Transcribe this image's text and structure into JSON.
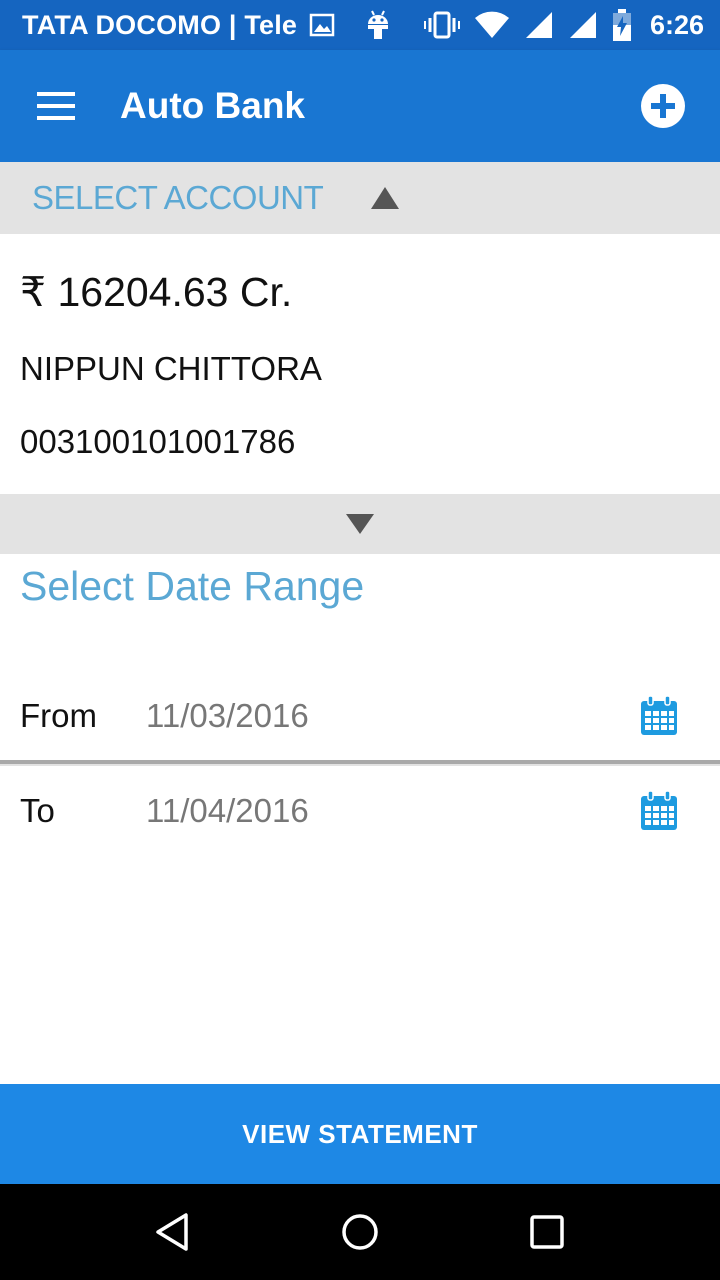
{
  "status_bar": {
    "carrier": "TATA DOCOMO | Tele",
    "time": "6:26",
    "icons": [
      "image-icon",
      "android-icon",
      "vibrate-icon",
      "wifi-icon",
      "signal-icon",
      "signal-icon",
      "battery-charging-icon"
    ]
  },
  "app_bar": {
    "title": "Auto Bank",
    "menu_icon": "hamburger-menu-icon",
    "action_icon": "add-circle-icon"
  },
  "account": {
    "header_label": "SELECT ACCOUNT",
    "balance": "₹ 16204.63 Cr.",
    "holder_name": "NIPPUN CHITTORA",
    "account_number": "003100101001786"
  },
  "date_range": {
    "title": "Select Date Range",
    "from_label": "From",
    "from_value": "11/03/2016",
    "to_label": "To",
    "to_value": "11/04/2016"
  },
  "actions": {
    "view_statement": "VIEW STATEMENT"
  },
  "nav_bar": {
    "icons": [
      "back-icon",
      "home-icon",
      "recents-icon"
    ]
  },
  "colors": {
    "status_bar": "#1565C0",
    "app_bar": "#1976D2",
    "accent_text": "#5BA8D4",
    "button": "#1E88E5",
    "section_bg": "#E3E3E3",
    "calendar_icon": "#1E9BE0"
  }
}
